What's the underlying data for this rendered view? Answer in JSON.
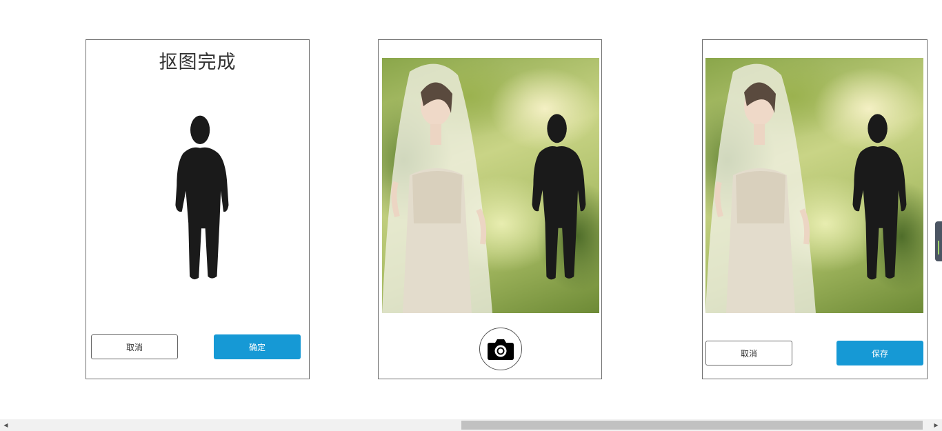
{
  "left_panel": {
    "title": "抠图完成",
    "cancel_label": "取消",
    "confirm_label": "确定"
  },
  "middle_panel": {
    "camera_icon": "camera-icon"
  },
  "right_panel": {
    "cancel_label": "取消",
    "save_label": "保存"
  },
  "colors": {
    "primary_button": "#1699d5",
    "silhouette": "#1a1a1a",
    "panel_border": "#6e6e6e"
  },
  "scrollbar": {
    "left_arrow_icon": "scroll-left-icon",
    "right_arrow_icon": "scroll-right-icon"
  }
}
